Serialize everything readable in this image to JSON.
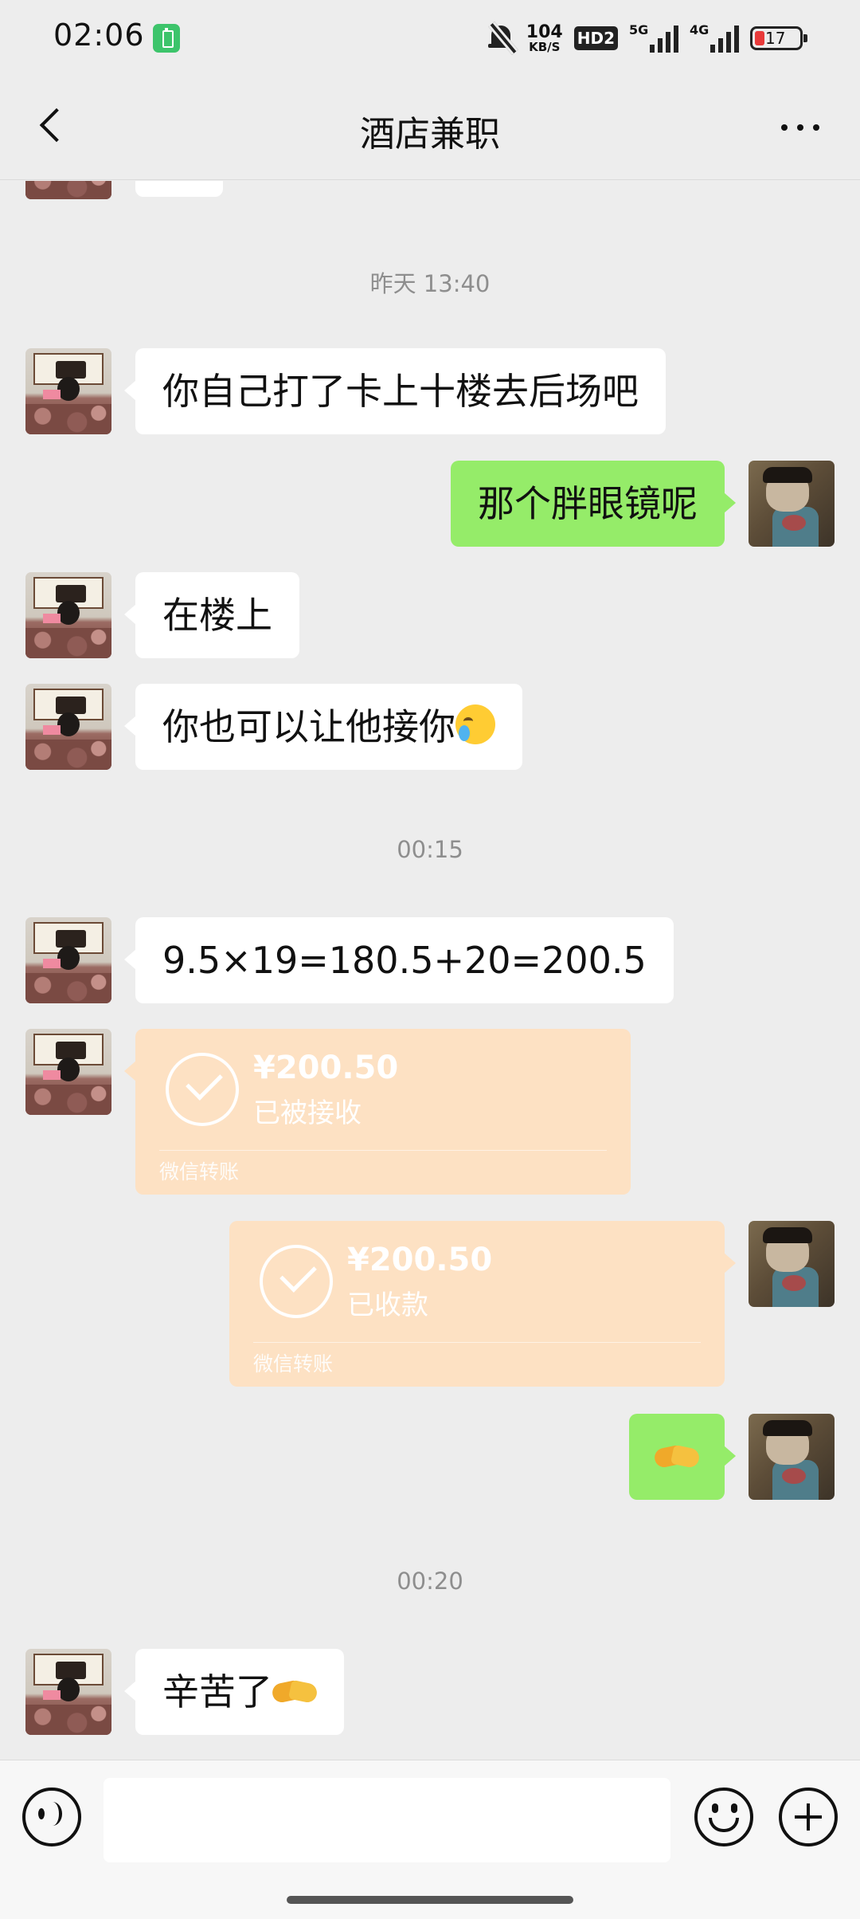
{
  "status_bar": {
    "time": "02:06",
    "net_speed_value": "104",
    "net_speed_unit": "KB/S",
    "hd_label": "HD2",
    "signal1_label": "5G",
    "signal2_label": "4G",
    "battery_level": "17",
    "icons": [
      "battery-charging-notification-icon",
      "bell-muted-icon",
      "signal-5g-icon",
      "signal-4g-icon",
      "battery-icon"
    ]
  },
  "nav": {
    "title": "酒店兼职",
    "icons": [
      "back-arrow-icon",
      "more-icon"
    ]
  },
  "chat": {
    "timestamps": [
      "昨天 13:40",
      "00:15",
      "00:20"
    ],
    "messages": [
      {
        "side": "left",
        "text": "你自己打了卡上十楼去后场吧"
      },
      {
        "side": "right",
        "text": "那个胖眼镜呢"
      },
      {
        "side": "left",
        "text": "在楼上"
      },
      {
        "side": "left",
        "text": "你也可以让他接你",
        "emoji": "crying-laughing-emoji"
      },
      {
        "side": "left",
        "text": "9.5×19=180.5+20=200.5"
      },
      {
        "side": "right",
        "text": "",
        "emoji": "handshake-emoji"
      },
      {
        "side": "left",
        "text": "辛苦了",
        "emoji": "handshake-emoji"
      }
    ],
    "transfers": [
      {
        "side": "left",
        "amount": "¥200.50",
        "status": "已被接收",
        "footer": "微信转账"
      },
      {
        "side": "right",
        "amount": "¥200.50",
        "status": "已收款",
        "footer": "微信转账"
      }
    ]
  },
  "input_bar": {
    "value": "",
    "icons": [
      "voice-icon",
      "emoji-icon",
      "plus-icon"
    ]
  }
}
